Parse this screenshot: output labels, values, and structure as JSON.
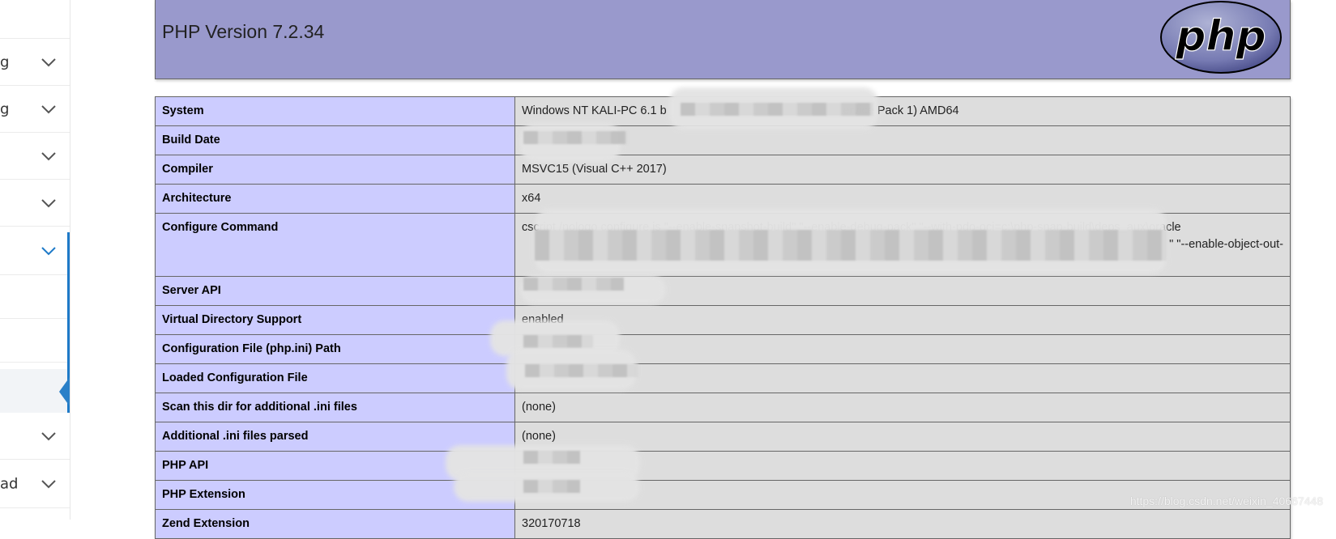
{
  "sidebar": {
    "items": [
      {
        "label": "",
        "expand": "chevron-down"
      },
      {
        "label": "g",
        "expand": "chevron-down"
      },
      {
        "label": "",
        "expand": "chevron-down"
      },
      {
        "label": "",
        "expand": "chevron-down"
      },
      {
        "label": "",
        "expand": "chevron-down",
        "active": true
      },
      {
        "label": "",
        "expand": ""
      },
      {
        "label": "",
        "expand": ""
      },
      {
        "label": "",
        "expand": "",
        "selected": true
      },
      {
        "label": "",
        "expand": "chevron-down"
      },
      {
        "label": "ad",
        "expand": "chevron-down"
      }
    ],
    "accent_color": "#1e7ac8"
  },
  "header": {
    "title": "PHP Version 7.2.34",
    "logo_text": "php",
    "background": "#9999cc"
  },
  "info_table": {
    "rows": [
      {
        "key": "System",
        "value": "Windows NT KALI-PC 6.1 b                                                      ervice Pack 1) AMD64"
      },
      {
        "key": "Build Date",
        "value": "                 0"
      },
      {
        "key": "Compiler",
        "value": "MSVC15 (Visual C++ 2017)"
      },
      {
        "key": "Architecture",
        "value": "x64"
      },
      {
        "key": "Configure Command",
        "value": "cscript /nologo configure.js \"--enable-snapshot-build\" \"--enable-debug-pack\" \"--with-pdo-oci=c:\\php-snap-build\\deps_aux\\oracle",
        "value2": "                                                                                                                        \" \"--enable-object-out-"
      },
      {
        "key": "Server API",
        "value": ""
      },
      {
        "key": "Virtual Directory Support",
        "value": "enabled"
      },
      {
        "key": "Configuration File (php.ini) Path",
        "value": ""
      },
      {
        "key": "Loaded Configuration File",
        "value": ""
      },
      {
        "key": "Scan this dir for additional .ini files",
        "value": "(none)"
      },
      {
        "key": "Additional .ini files parsed",
        "value": "(none)"
      },
      {
        "key": "PHP API",
        "value": ""
      },
      {
        "key": "PHP Extension",
        "value": ""
      },
      {
        "key": "Zend Extension",
        "value": "320170718"
      }
    ],
    "key_background": "#ccccff",
    "value_background": "#dddddd"
  },
  "watermark": "https://blog.csdn.net/weixin_40667448"
}
